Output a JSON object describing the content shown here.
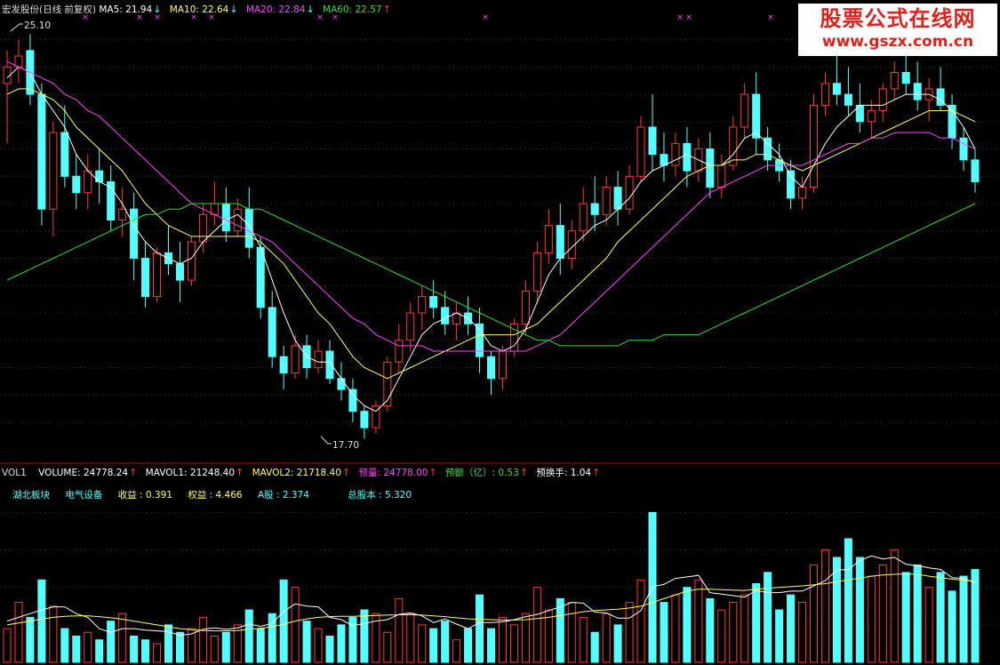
{
  "price_header": {
    "title": "宏发股份(日线 前复权)",
    "ma5_label": "MA5: 21.94",
    "ma5_arrow": "↓",
    "ma10_label": "MA10: 22.64",
    "ma10_arrow": "↓",
    "ma20_label": "MA20: 22.84",
    "ma20_arrow": "↓",
    "ma60_label": "MA60: 22.57",
    "ma60_arrow": "↑"
  },
  "volume_header": {
    "vol_label": "VOL1",
    "volume_label": "VOLUME: 24778.24",
    "volume_arrow": "↑",
    "mavol1_label": "MAVOL1: 21248.40",
    "mavol1_arrow": "↑",
    "mavol2_label": "MAVOL2: 21718.40",
    "mavol2_arrow": "↑",
    "forecast_vol_label": "预量: 24778.00",
    "forecast_vol_arrow": "↑",
    "forecast_amt_label": "预额（亿）: 0.53",
    "forecast_amt_arrow": "↑",
    "forecast_turnover_label": "预换手: 1.04",
    "forecast_turnover_arrow": "↑"
  },
  "info_row": {
    "region": "湖北板块",
    "industry": "电气设备",
    "eps": "收益 : 0.391",
    "equity": "权益 : 4.466",
    "a_share": "A股 :  2.374",
    "total_share": "总股本 : 5.320"
  },
  "watermark": {
    "title": "股票公式在线网",
    "url": "www.gszx.com.cn"
  },
  "colors": {
    "up": "#ff3a3a",
    "down": "#54ffff",
    "ma5": "#ffffff",
    "ma10": "#ffff66",
    "ma20": "#ff44ff",
    "ma60": "#33dd33",
    "vol_ma1": "#ffffff",
    "vol_ma2": "#ffff66",
    "grid": "#5a2a2a",
    "divider": "#a01010"
  },
  "chart_data": [
    {
      "type": "candlestick",
      "title": "宏发股份(日线 前复权)",
      "ylim": [
        17.3,
        25.4
      ],
      "grid": true,
      "annotations": [
        {
          "label": "25.10",
          "value": 25.1,
          "bar_index": 2
        },
        {
          "label": "17.70",
          "value": 17.7,
          "bar_index": 92
        }
      ],
      "ohlc": [
        [
          24.2,
          24.8,
          23.1,
          24.5
        ],
        [
          24.5,
          25.0,
          24.2,
          24.7
        ],
        [
          24.8,
          25.1,
          23.8,
          24.0
        ],
        [
          24.0,
          24.2,
          21.6,
          21.9
        ],
        [
          21.9,
          23.5,
          21.4,
          23.3
        ],
        [
          23.3,
          23.8,
          22.3,
          22.5
        ],
        [
          22.5,
          22.9,
          21.9,
          22.2
        ],
        [
          22.2,
          22.9,
          21.9,
          22.6
        ],
        [
          22.6,
          23.0,
          22.0,
          22.4
        ],
        [
          22.4,
          22.7,
          21.5,
          21.7
        ],
        [
          21.7,
          22.3,
          21.4,
          21.9
        ],
        [
          21.9,
          22.2,
          20.6,
          21.0
        ],
        [
          21.0,
          21.3,
          20.1,
          20.3
        ],
        [
          20.3,
          21.2,
          20.2,
          21.1
        ],
        [
          21.1,
          21.6,
          20.7,
          20.9
        ],
        [
          20.9,
          21.3,
          20.2,
          20.6
        ],
        [
          20.6,
          21.4,
          20.5,
          21.3
        ],
        [
          21.3,
          22.0,
          21.1,
          21.8
        ],
        [
          21.8,
          22.4,
          21.6,
          22.0
        ],
        [
          22.0,
          22.3,
          21.3,
          21.5
        ],
        [
          21.5,
          22.1,
          21.4,
          21.9
        ],
        [
          21.9,
          22.3,
          21.0,
          21.2
        ],
        [
          21.2,
          21.4,
          19.9,
          20.1
        ],
        [
          20.1,
          20.4,
          19.0,
          19.2
        ],
        [
          19.2,
          19.4,
          18.6,
          18.9
        ],
        [
          18.9,
          19.6,
          18.8,
          19.4
        ],
        [
          19.4,
          19.6,
          18.8,
          19.0
        ],
        [
          19.0,
          19.5,
          18.9,
          19.3
        ],
        [
          19.3,
          19.5,
          18.7,
          18.8
        ],
        [
          18.8,
          19.1,
          18.4,
          18.6
        ],
        [
          18.6,
          18.8,
          18.0,
          18.2
        ],
        [
          18.2,
          18.3,
          17.7,
          17.9
        ],
        [
          17.9,
          18.4,
          17.8,
          18.3
        ],
        [
          18.3,
          19.2,
          18.2,
          19.1
        ],
        [
          19.1,
          19.8,
          18.9,
          19.5
        ],
        [
          19.5,
          20.2,
          19.3,
          20.0
        ],
        [
          20.0,
          20.5,
          19.7,
          20.3
        ],
        [
          20.3,
          20.6,
          19.9,
          20.1
        ],
        [
          20.1,
          20.4,
          19.6,
          19.8
        ],
        [
          19.8,
          20.2,
          19.5,
          20.0
        ],
        [
          20.0,
          20.3,
          19.6,
          19.8
        ],
        [
          19.8,
          20.1,
          18.9,
          19.2
        ],
        [
          19.2,
          19.3,
          18.5,
          18.8
        ],
        [
          18.8,
          19.4,
          18.6,
          19.3
        ],
        [
          19.3,
          19.9,
          19.2,
          19.8
        ],
        [
          19.8,
          20.6,
          19.6,
          20.4
        ],
        [
          20.4,
          21.3,
          20.2,
          21.1
        ],
        [
          21.1,
          21.9,
          20.9,
          21.6
        ],
        [
          21.6,
          22.0,
          20.7,
          21.0
        ],
        [
          21.0,
          21.7,
          20.8,
          21.5
        ],
        [
          21.5,
          22.3,
          21.3,
          22.0
        ],
        [
          22.0,
          22.5,
          21.5,
          21.8
        ],
        [
          21.8,
          22.5,
          21.6,
          22.3
        ],
        [
          22.3,
          22.6,
          21.6,
          21.9
        ],
        [
          21.9,
          22.7,
          21.8,
          22.5
        ],
        [
          22.5,
          23.6,
          22.4,
          23.4
        ],
        [
          23.4,
          24.0,
          22.6,
          22.9
        ],
        [
          22.9,
          23.3,
          22.4,
          22.7
        ],
        [
          22.7,
          23.3,
          22.5,
          23.1
        ],
        [
          23.1,
          23.4,
          22.3,
          22.6
        ],
        [
          22.6,
          23.2,
          22.4,
          23.0
        ],
        [
          23.0,
          23.3,
          22.1,
          22.3
        ],
        [
          22.3,
          22.9,
          22.1,
          22.7
        ],
        [
          22.7,
          23.6,
          22.6,
          23.4
        ],
        [
          23.4,
          24.2,
          23.2,
          24.0
        ],
        [
          24.0,
          24.4,
          22.9,
          23.2
        ],
        [
          23.2,
          23.4,
          22.6,
          22.8
        ],
        [
          22.8,
          23.1,
          22.4,
          22.6
        ],
        [
          22.6,
          22.8,
          21.9,
          22.1
        ],
        [
          22.1,
          22.5,
          21.9,
          22.3
        ],
        [
          22.3,
          24.0,
          22.2,
          23.8
        ],
        [
          23.8,
          24.4,
          23.6,
          24.2
        ],
        [
          24.2,
          24.7,
          23.8,
          24.0
        ],
        [
          24.0,
          24.5,
          23.6,
          23.8
        ],
        [
          23.8,
          24.2,
          23.3,
          23.5
        ],
        [
          23.5,
          23.9,
          23.2,
          23.7
        ],
        [
          23.7,
          24.2,
          23.5,
          24.1
        ],
        [
          24.1,
          24.6,
          23.9,
          24.4
        ],
        [
          24.4,
          24.8,
          24.0,
          24.2
        ],
        [
          24.2,
          24.6,
          23.7,
          23.9
        ],
        [
          23.9,
          24.3,
          23.5,
          24.1
        ],
        [
          24.1,
          24.5,
          23.7,
          23.8
        ],
        [
          23.8,
          24.0,
          23.0,
          23.2
        ],
        [
          23.2,
          23.4,
          22.6,
          22.8
        ],
        [
          22.8,
          23.0,
          22.2,
          22.4
        ]
      ],
      "ma": {
        "MA5": [
          24.3,
          24.5,
          24.4,
          24.0,
          23.7,
          23.4,
          22.9,
          22.6,
          22.4,
          22.3,
          22.0,
          21.6,
          21.3,
          21.1,
          21.0,
          20.9,
          21.0,
          21.3,
          21.5,
          21.7,
          21.8,
          21.6,
          21.2,
          20.6,
          20.0,
          19.5,
          19.2,
          19.1,
          19.1,
          18.8,
          18.5,
          18.3,
          18.2,
          18.4,
          18.8,
          19.2,
          19.6,
          19.8,
          19.9,
          20.0,
          19.9,
          19.7,
          19.4,
          19.3,
          19.4,
          19.7,
          20.2,
          20.7,
          21.0,
          21.2,
          21.4,
          21.6,
          21.7,
          21.9,
          22.1,
          22.4,
          22.6,
          22.7,
          22.8,
          22.9,
          22.8,
          22.7,
          22.7,
          22.9,
          23.2,
          23.3,
          23.1,
          22.9,
          22.5,
          22.3,
          22.7,
          23.1,
          23.4,
          23.6,
          23.8,
          23.8,
          23.8,
          23.9,
          24.0,
          24.0,
          24.0,
          23.9,
          23.7,
          23.4,
          23.0
        ],
        "MA10": [
          24.0,
          24.1,
          24.1,
          24.0,
          23.9,
          23.7,
          23.4,
          23.2,
          23.0,
          22.8,
          22.6,
          22.3,
          22.0,
          21.8,
          21.6,
          21.5,
          21.4,
          21.4,
          21.4,
          21.4,
          21.4,
          21.4,
          21.3,
          21.1,
          20.9,
          20.6,
          20.3,
          20.0,
          19.8,
          19.5,
          19.2,
          19.0,
          18.9,
          18.8,
          18.9,
          19.0,
          19.1,
          19.2,
          19.3,
          19.4,
          19.5,
          19.6,
          19.6,
          19.6,
          19.6,
          19.7,
          19.8,
          20.0,
          20.2,
          20.4,
          20.6,
          20.8,
          21.0,
          21.3,
          21.5,
          21.7,
          21.9,
          22.1,
          22.3,
          22.5,
          22.6,
          22.7,
          22.7,
          22.8,
          22.8,
          22.9,
          22.9,
          22.8,
          22.7,
          22.6,
          22.7,
          22.8,
          22.9,
          23.0,
          23.1,
          23.2,
          23.3,
          23.4,
          23.5,
          23.6,
          23.7,
          23.7,
          23.7,
          23.6,
          23.5
        ],
        "MA20": [
          24.6,
          24.5,
          24.4,
          24.3,
          24.2,
          24.0,
          23.9,
          23.7,
          23.6,
          23.4,
          23.2,
          23.0,
          22.8,
          22.6,
          22.4,
          22.2,
          22.0,
          21.9,
          21.8,
          21.7,
          21.6,
          21.5,
          21.4,
          21.3,
          21.1,
          20.9,
          20.7,
          20.5,
          20.3,
          20.1,
          19.9,
          19.8,
          19.6,
          19.5,
          19.4,
          19.4,
          19.4,
          19.3,
          19.3,
          19.3,
          19.3,
          19.3,
          19.3,
          19.3,
          19.3,
          19.3,
          19.4,
          19.5,
          19.6,
          19.8,
          20.0,
          20.2,
          20.4,
          20.6,
          20.8,
          21.0,
          21.2,
          21.4,
          21.6,
          21.8,
          22.0,
          22.2,
          22.3,
          22.4,
          22.5,
          22.6,
          22.7,
          22.7,
          22.7,
          22.7,
          22.8,
          22.9,
          23.0,
          23.1,
          23.1,
          23.2,
          23.2,
          23.3,
          23.3,
          23.3,
          23.3,
          23.2,
          23.2,
          23.1,
          23.0
        ],
        "MA60": [
          20.6,
          20.7,
          20.8,
          20.9,
          21.0,
          21.1,
          21.2,
          21.3,
          21.4,
          21.5,
          21.6,
          21.7,
          21.8,
          21.8,
          21.9,
          21.9,
          22.0,
          22.0,
          22.0,
          22.0,
          22.0,
          21.9,
          21.9,
          21.8,
          21.7,
          21.6,
          21.5,
          21.4,
          21.3,
          21.2,
          21.1,
          21.0,
          20.9,
          20.8,
          20.7,
          20.6,
          20.5,
          20.4,
          20.3,
          20.2,
          20.1,
          20.0,
          19.9,
          19.8,
          19.7,
          19.6,
          19.5,
          19.5,
          19.4,
          19.4,
          19.4,
          19.4,
          19.4,
          19.4,
          19.5,
          19.5,
          19.5,
          19.6,
          19.6,
          19.6,
          19.6,
          19.7,
          19.8,
          19.9,
          20.0,
          20.1,
          20.2,
          20.3,
          20.4,
          20.5,
          20.6,
          20.7,
          20.8,
          20.9,
          21.0,
          21.1,
          21.2,
          21.3,
          21.4,
          21.5,
          21.6,
          21.7,
          21.8,
          21.9,
          22.0
        ]
      }
    },
    {
      "type": "bar",
      "title": "VOL1",
      "ylim": [
        0,
        42000
      ],
      "values": [
        9000,
        16000,
        12000,
        22000,
        15000,
        9000,
        7000,
        8000,
        6000,
        11000,
        13000,
        7000,
        6000,
        5000,
        10000,
        8000,
        9000,
        12000,
        7000,
        8000,
        10000,
        14000,
        9000,
        13000,
        22000,
        20000,
        11000,
        9000,
        7000,
        10000,
        12000,
        14000,
        13000,
        8000,
        17000,
        13000,
        10000,
        9000,
        11000,
        6000,
        9000,
        18000,
        9000,
        12000,
        10000,
        13000,
        20000,
        14000,
        17000,
        16000,
        12000,
        8000,
        13000,
        10000,
        16000,
        22000,
        40000,
        16000,
        18000,
        20000,
        22000,
        17000,
        14000,
        16000,
        18000,
        21000,
        24000,
        14000,
        18000,
        16000,
        26000,
        30000,
        28000,
        33000,
        28000,
        23000,
        26000,
        30000,
        24000,
        26000,
        20000,
        24000,
        19000,
        23000,
        24778
      ],
      "series": [
        {
          "name": "MAVOL1",
          "values": [
            11000,
            12000,
            13000,
            14000,
            14800,
            14800,
            13000,
            12000,
            9000,
            8000,
            9000,
            9000,
            8600,
            8400,
            8200,
            7200,
            7600,
            8800,
            9200,
            8800,
            9200,
            10200,
            9600,
            10400,
            13600,
            15600,
            15000,
            14800,
            12000,
            11400,
            9800,
            10400,
            11000,
            11400,
            12800,
            13200,
            12400,
            10600,
            11600,
            10200,
            9000,
            10600,
            10600,
            10800,
            11400,
            12200,
            12800,
            13800,
            14800,
            16000,
            15800,
            13400,
            13200,
            11800,
            11800,
            13800,
            20200,
            20800,
            22400,
            22800,
            23200,
            18600,
            18200,
            17800,
            17400,
            19200,
            18600,
            18600,
            19000,
            19000,
            20400,
            21800,
            24600,
            24800,
            27200,
            28400,
            27600,
            28000,
            26200,
            25800,
            25200,
            24800,
            22600,
            22400,
            21248
          ]
        },
        {
          "name": "MAVOL2",
          "values": [
            10000,
            10500,
            11000,
            11500,
            12000,
            12300,
            12400,
            12400,
            12200,
            11900,
            11500,
            11000,
            10500,
            10000,
            9500,
            9000,
            8700,
            8500,
            8400,
            8400,
            8500,
            8800,
            9100,
            9500,
            10200,
            11000,
            11600,
            12000,
            12200,
            12300,
            12300,
            12400,
            12500,
            12600,
            12700,
            12700,
            12600,
            12400,
            12200,
            11900,
            11600,
            11500,
            11400,
            11300,
            11300,
            11400,
            11700,
            12000,
            12500,
            13000,
            13500,
            13800,
            14000,
            14200,
            14500,
            15000,
            16000,
            17000,
            18000,
            19000,
            19500,
            19500,
            19400,
            19300,
            19200,
            19500,
            19800,
            20000,
            20200,
            20400,
            20700,
            21000,
            21500,
            22000,
            22500,
            23000,
            23300,
            23500,
            23600,
            23500,
            23000,
            22600,
            22200,
            21900,
            21718
          ]
        }
      ]
    }
  ]
}
